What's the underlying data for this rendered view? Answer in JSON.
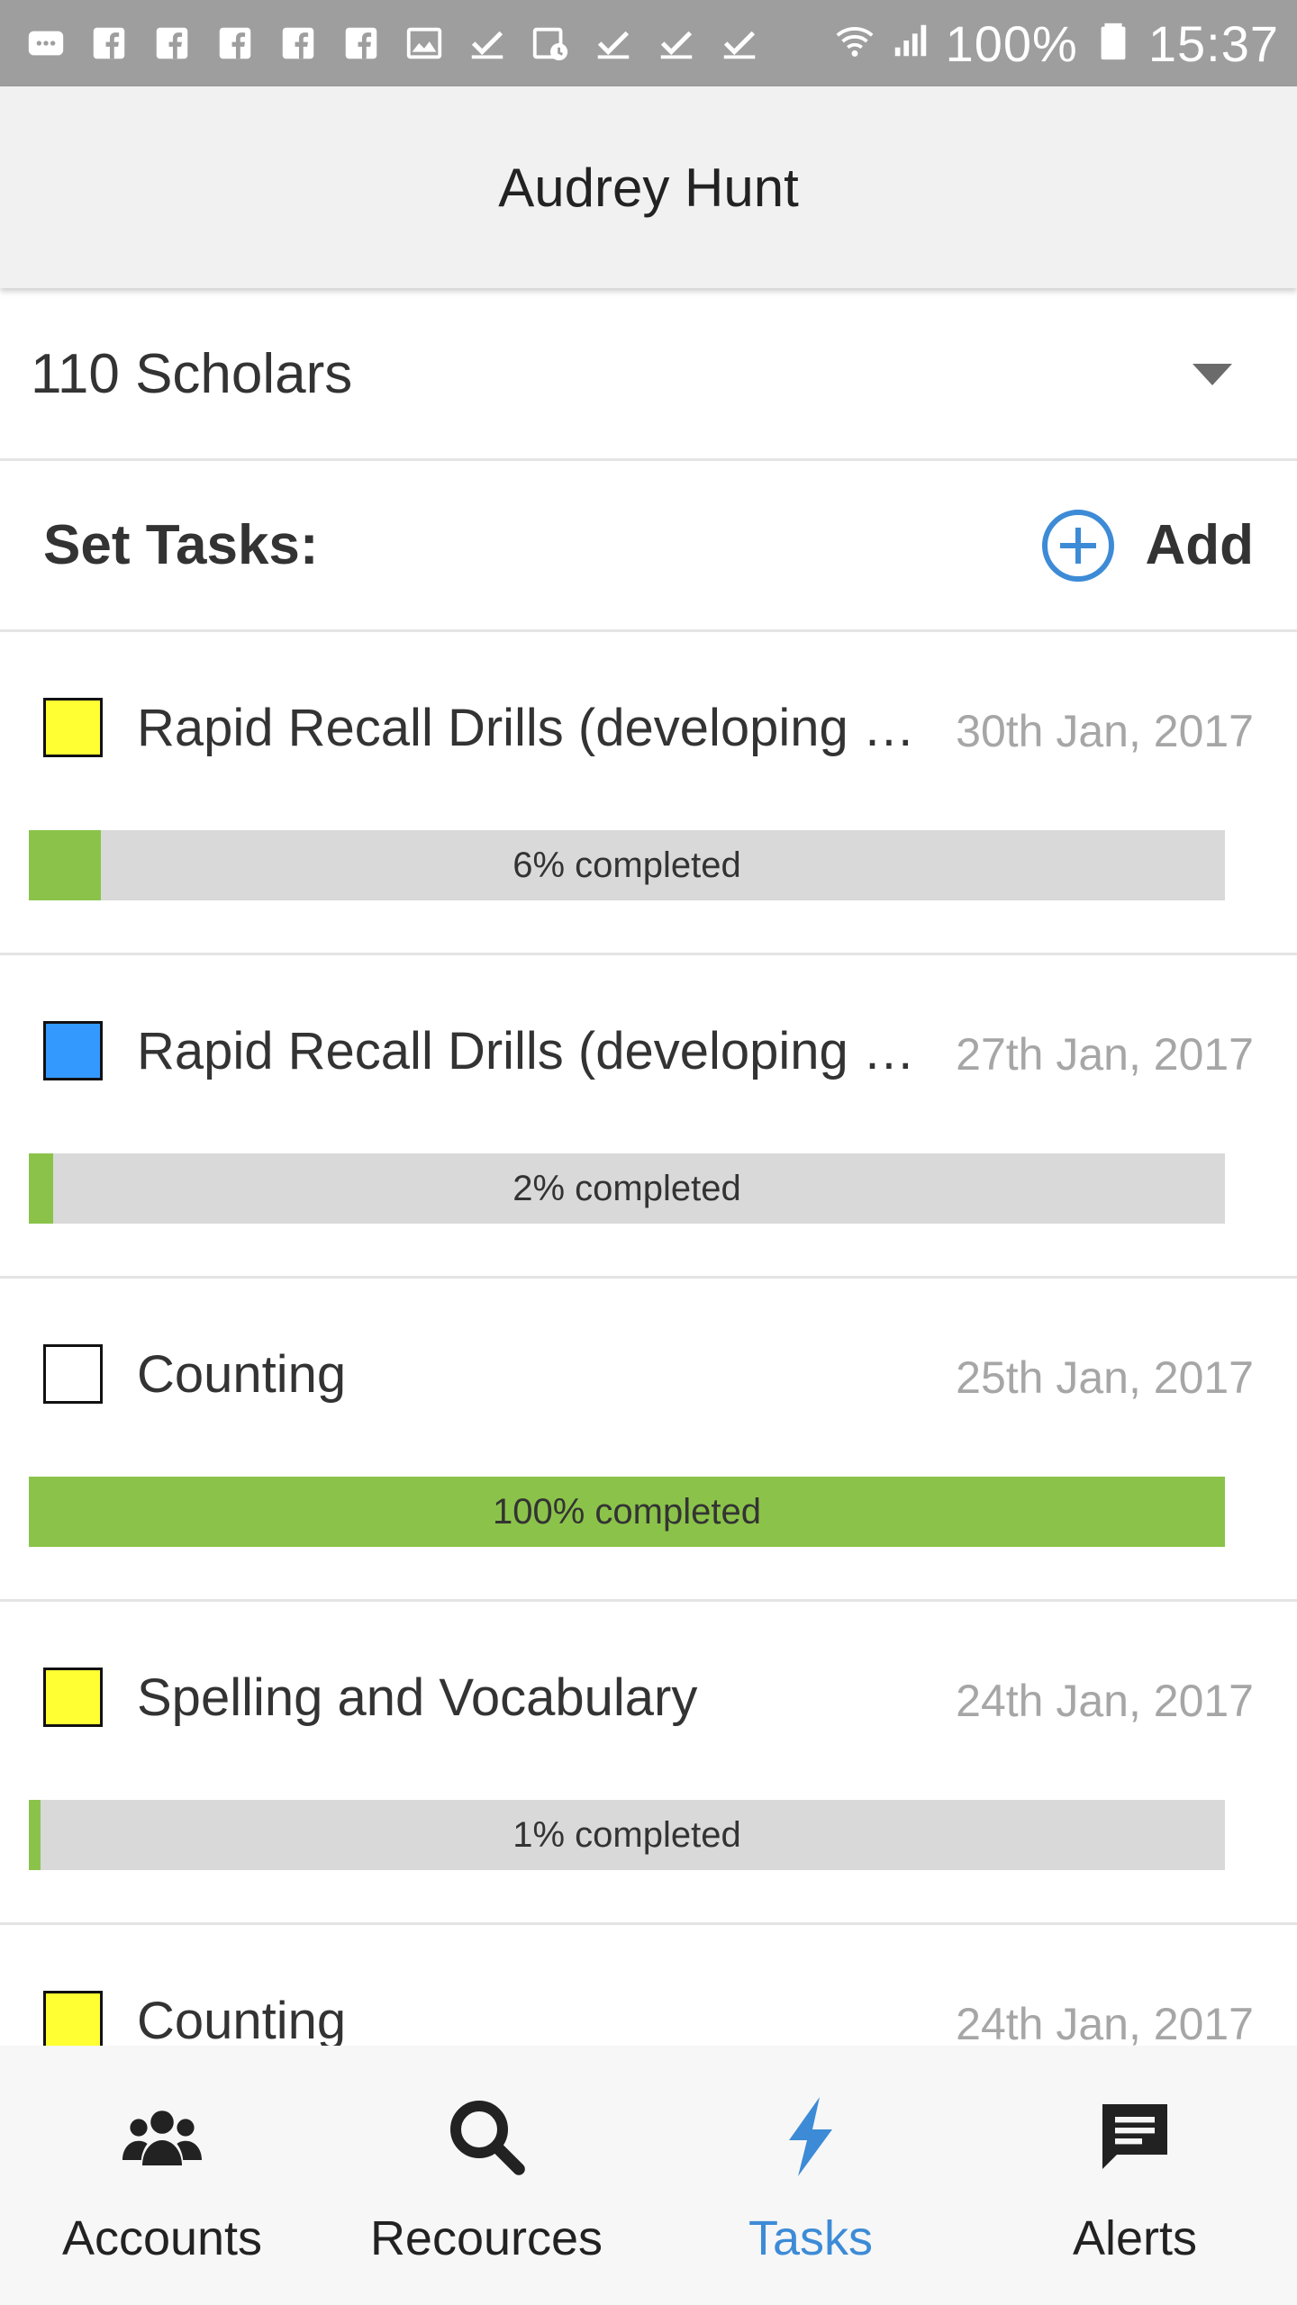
{
  "status_bar": {
    "battery": "100%",
    "time": "15:37",
    "notification_icons": [
      "message-icon",
      "facebook-icon",
      "facebook-icon",
      "facebook-icon",
      "facebook-icon",
      "facebook-icon",
      "image-icon",
      "check-icon",
      "calendar-clock-icon",
      "check-icon",
      "check-icon",
      "check-icon"
    ]
  },
  "header": {
    "title": "Audrey Hunt"
  },
  "selector": {
    "label": "110 Scholars"
  },
  "tasks_section": {
    "title": "Set Tasks:",
    "add_label": "Add"
  },
  "colors": {
    "accent": "#3d8bd6",
    "progress_fill": "#8bc34a",
    "progress_track": "#d9d9d9"
  },
  "tasks": [
    {
      "title": "Rapid Recall Drills (developing memory)",
      "date": "30th Jan, 2017",
      "swatch": "#ffff33",
      "progress": 6,
      "progress_text": "6%  completed"
    },
    {
      "title": "Rapid Recall Drills (developing memory)",
      "date": "27th Jan, 2017",
      "swatch": "#3399ff",
      "progress": 2,
      "progress_text": "2%  completed"
    },
    {
      "title": "Counting",
      "date": "25th Jan, 2017",
      "swatch": "#ffffff",
      "progress": 100,
      "progress_text": "100%  completed"
    },
    {
      "title": "Spelling and Vocabulary",
      "date": "24th Jan, 2017",
      "swatch": "#ffff33",
      "progress": 1,
      "progress_text": "1%  completed"
    },
    {
      "title": "Counting",
      "date": "24th Jan, 2017",
      "swatch": "#ffff33",
      "progress": 0,
      "progress_text": ""
    }
  ],
  "bottom_nav": [
    {
      "label": "Accounts",
      "icon": "people-icon",
      "active": false
    },
    {
      "label": "Recources",
      "icon": "search-icon",
      "active": false
    },
    {
      "label": "Tasks",
      "icon": "lightning-icon",
      "active": true
    },
    {
      "label": "Alerts",
      "icon": "chat-icon",
      "active": false
    }
  ]
}
